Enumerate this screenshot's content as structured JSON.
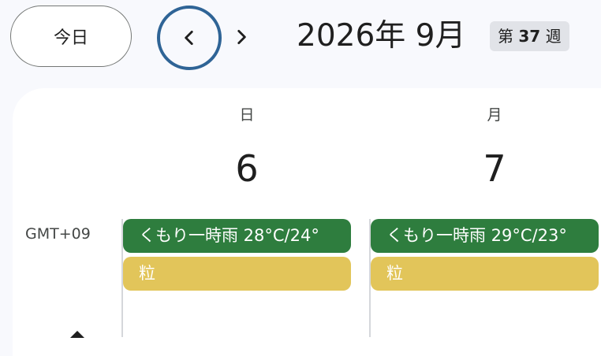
{
  "toolbar": {
    "today_label": "今日",
    "prev_icon": "chevron-left-icon",
    "next_icon": "chevron-right-icon",
    "month_title": "2026年 9月",
    "week_prefix": "第",
    "week_number": "37",
    "week_suffix": "週"
  },
  "grid": {
    "timezone": "GMT+09",
    "days": [
      {
        "dow": "日",
        "date": "6",
        "events": [
          {
            "label": "くもり一時雨 28°C/24°",
            "type": "weather"
          },
          {
            "label": "粒",
            "type": "grain"
          }
        ]
      },
      {
        "dow": "月",
        "date": "7",
        "events": [
          {
            "label": "くもり一時雨 29°C/23°",
            "type": "weather"
          },
          {
            "label": "粒",
            "type": "grain"
          }
        ]
      }
    ]
  },
  "colors": {
    "focus_ring": "#2f6496",
    "weather_event": "#2e7d3e",
    "grain_event": "#e2c55a",
    "week_badge_bg": "#e1e3e8"
  }
}
